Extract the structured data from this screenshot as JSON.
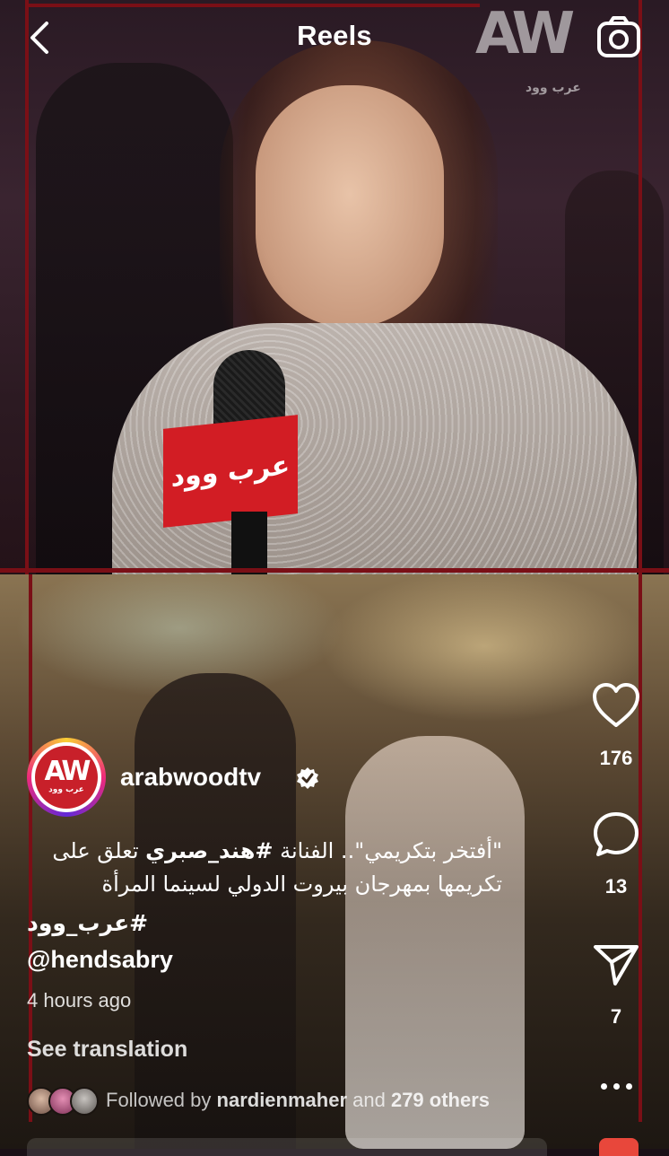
{
  "header": {
    "title": "Reels",
    "back_icon": "chevron-left-icon",
    "camera_icon": "camera-icon"
  },
  "video": {
    "watermark": "AW",
    "watermark_arabic": "عرب وود",
    "mic_flag_text": "عرب وود"
  },
  "actions": {
    "likes": "176",
    "comments": "13",
    "shares": "7"
  },
  "author": {
    "avatar_logo": "AW",
    "avatar_logo_sub": "عرب وود",
    "username": "arabwoodtv",
    "verified": true
  },
  "caption": {
    "line1_prefix": "\"أفتخر بتكريمي\".. الفنانة ",
    "line1_hashtag": "#هند_صبري",
    "line1_suffix": " تعلق على",
    "line2": "تكريمها بمهرجان بيروت الدولي لسينما المرأة",
    "hashtag": "#عرب_وود",
    "mention": "@hendsabry",
    "time_ago": "4 hours ago",
    "see_translation": "See translation"
  },
  "followed_by": {
    "prefix": "Followed by ",
    "user": "nardienmaher",
    "middle": " and ",
    "others": "279 others"
  },
  "colors": {
    "frame_red": "#7a0f16",
    "brand_red": "#c8202a"
  }
}
